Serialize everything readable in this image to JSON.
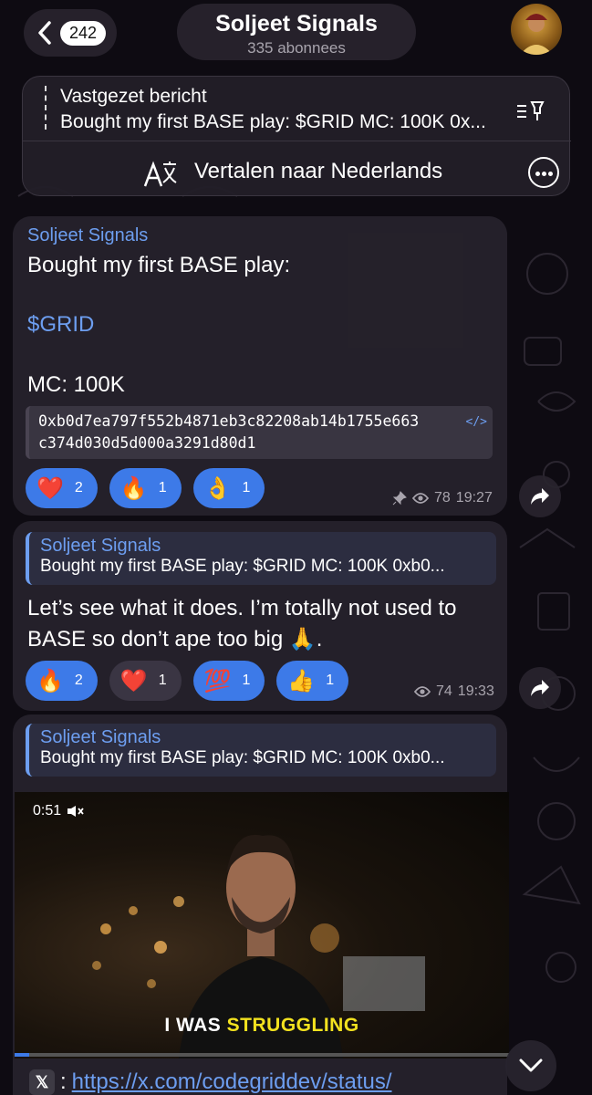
{
  "header": {
    "back_badge": "242",
    "channel_name": "Soljeet Signals",
    "subscribers": "335 abonnees"
  },
  "pinned": {
    "title": "Vastgezet bericht",
    "text": "Bought my first BASE play: $GRID MC: 100K 0x...",
    "translate_label": "Vertalen naar Nederlands"
  },
  "messages": [
    {
      "sender": "Soljeet Signals",
      "line1": "Bought my first BASE play:",
      "cashtag": "$GRID",
      "line3": "MC: 100K",
      "address_line1": "0xb0d7ea797f552b4871eb3c82208ab14b1755e663",
      "address_line2": "c374d030d5d000a3291d80d1",
      "reactions": [
        {
          "emoji": "❤️",
          "count": "2"
        },
        {
          "emoji": "🔥",
          "count": "1"
        },
        {
          "emoji": "👌",
          "count": "1"
        }
      ],
      "views": "78",
      "time": "19:27"
    },
    {
      "reply_sender": "Soljeet Signals",
      "reply_text": "Bought my first BASE play: $GRID MC: 100K 0xb0...",
      "line1": "Let’s see what it does. I’m totally not used to",
      "line2": "BASE so don’t ape too big 🙏.",
      "reactions": [
        {
          "emoji": "🔥",
          "count": "2"
        },
        {
          "emoji": "❤️",
          "count": "1"
        },
        {
          "emoji": "💯",
          "count": "1"
        },
        {
          "emoji": "👍",
          "count": "1"
        }
      ],
      "views": "74",
      "time": "19:33"
    },
    {
      "reply_sender": "Soljeet Signals",
      "reply_text": "Bought my first BASE play: $GRID MC: 100K 0xb0...",
      "video_duration": "0:51",
      "caption_plain": "I WAS",
      "caption_highlight": "STRUGGLING",
      "video_progress": 0.03,
      "link_prefix": ":",
      "link": "https://x.com/codegriddev/status/"
    }
  ],
  "colors": {
    "accent": "#3d7ae8",
    "link": "#6d9ef0",
    "caption_highlight": "#f3e21f"
  }
}
